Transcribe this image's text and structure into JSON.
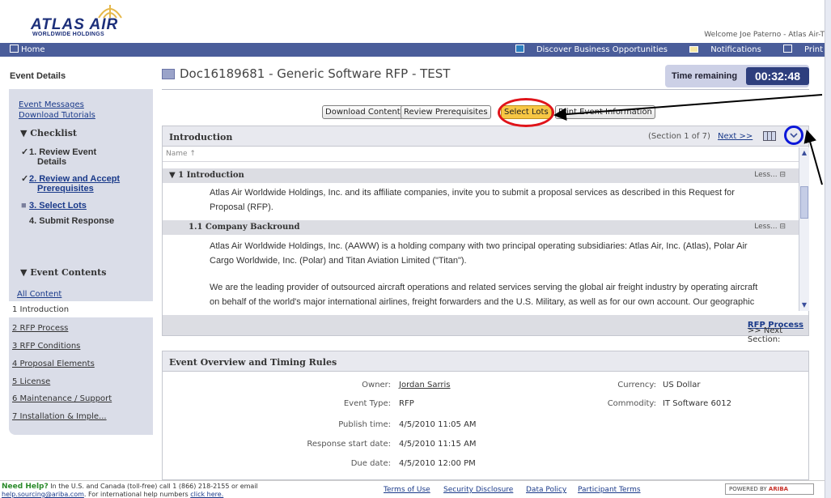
{
  "header": {
    "brand": "ATLAS AIR",
    "brand_sub": "WORLDWIDE HOLDINGS",
    "welcome": "Welcome Joe Paterno - Atlas Air-T"
  },
  "topbar": {
    "home": "Home",
    "discover": "Discover Business Opportunities",
    "notifications": "Notifications",
    "print": "Print"
  },
  "left": {
    "event_details": "Event Details",
    "event_messages": "Event Messages",
    "download_tutorials": "Download Tutorials",
    "checklist": "Checklist",
    "steps": [
      {
        "mark": "✓",
        "label_1": "1. Review Event",
        "label_2": "Details"
      },
      {
        "mark": "✓",
        "label_1": "2. Review and Accept",
        "label_2": "Prerequisites"
      },
      {
        "mark": "■",
        "label_1": "3. Select Lots",
        "label_2": ""
      },
      {
        "mark": "",
        "label_1": "4. Submit Response",
        "label_2": ""
      }
    ],
    "event_contents": "Event Contents",
    "all_content": "All Content",
    "nav": [
      "1 Introduction",
      "2 RFP Process",
      "3 RFP Conditions",
      "4 Proposal Elements",
      "5 License",
      "6 Maintenance / Support",
      "7 Installation & Imple..."
    ]
  },
  "main": {
    "doc_title": "Doc16189681 - Generic Software RFP - TEST",
    "time_remaining_label": "Time remaining",
    "time_remaining": "00:32:48",
    "buttons": {
      "download": "Download Content",
      "prereq": "Review Prerequisites",
      "select_lots": "Select Lots",
      "print": "Print Event Information"
    }
  },
  "intro": {
    "title": "Introduction",
    "section_info": "(Section 1 of 7)",
    "next": "Next >>",
    "name_col": "Name ↑",
    "group1": "▼ 1  Introduction",
    "group1_less": "Less... ⊟",
    "para1_a": "Atlas Air Worldwide Holdings, Inc. and its affiliate companies, invite you to submit a proposal services as described in this Request for",
    "para1_b": "Proposal (RFP).",
    "group2": "1.1  Company Backround",
    "group2_less": "Less... ⊟",
    "para2_a": "Atlas Air Worldwide Holdings, Inc. (AAWW) is a holding company with two principal operating subsidiaries: Atlas Air, Inc. (Atlas), Polar Air",
    "para2_b": "Cargo Worldwide, Inc. (Polar) and Titan Aviation Limited (\"Titan\").",
    "para3_a": "We are the leading provider of outsourced aircraft operations and related services serving the global air freight industry by operating aircraft",
    "para3_b": "on behalf of the world's major international airlines, freight forwarders and the U.S. Military, as well as for our own account.  Our geographic",
    "next_section_label": ">> Next Section:",
    "next_section": "RFP Process"
  },
  "overview": {
    "title": "Event Overview and Timing Rules",
    "owner_label": "Owner:",
    "owner": "Jordan Sarris",
    "currency_label": "Currency:",
    "currency": "US Dollar",
    "event_type_label": "Event Type:",
    "event_type": "RFP",
    "commodity_label": "Commodity:",
    "commodity": "IT Software 6012",
    "publish_label": "Publish time:",
    "publish": "4/5/2010 11:05 AM",
    "response_start_label": "Response start date:",
    "response_start": "4/5/2010 11:15 AM",
    "due_label": "Due date:",
    "due": "4/5/2010 12:00 PM"
  },
  "footer": {
    "help_bold": "Need Help?",
    "help_text": "In the U.S. and Canada (toll-free) call 1 (866) 218-2155 or email",
    "help_email": "help.sourcing@ariba.com",
    "help_text2": ". For international help numbers",
    "help_link": "click here.",
    "terms": "Terms of Use",
    "security": "Security Disclosure",
    "data_policy": "Data Policy",
    "participant": "Participant Terms",
    "powered": "POWERED BY",
    "ariba": "ARIBA"
  },
  "colors": {
    "nav_bar": "#4a5d9a",
    "timer": "#2e3f7e",
    "select_lots": "#f7c744",
    "annotation_red": "#e0141a",
    "annotation_blue": "#0b17d9"
  }
}
